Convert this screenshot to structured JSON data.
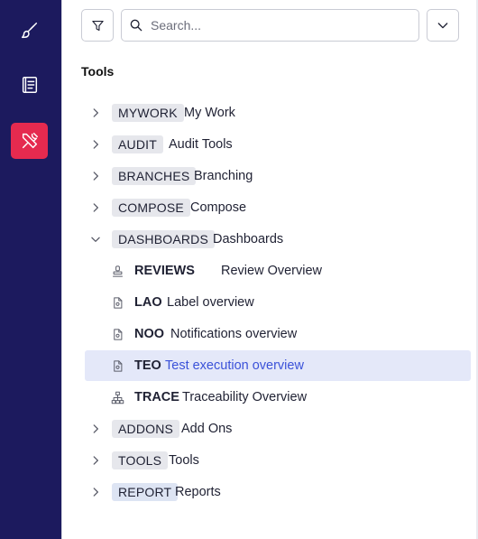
{
  "search": {
    "placeholder": "Search..."
  },
  "section_title": "Tools",
  "tree": {
    "mywork": {
      "code": "MYWORK",
      "label": "My Work"
    },
    "audit": {
      "code": "AUDIT",
      "label": "Audit Tools"
    },
    "branches": {
      "code": "BRANCHES",
      "label": "Branching"
    },
    "compose": {
      "code": "COMPOSE",
      "label": "Compose"
    },
    "dashboards": {
      "code": "DASHBOARDS",
      "label": "Dashboards",
      "children": {
        "reviews": {
          "code": "REVIEWS",
          "label": "Review Overview"
        },
        "lao": {
          "code": "LAO",
          "label": "Label overview"
        },
        "noo": {
          "code": "NOO",
          "label": "Notifications overview"
        },
        "teo": {
          "code": "TEO",
          "label": "Test execution overview"
        },
        "trace": {
          "code": "TRACE",
          "label": "Traceability Overview"
        }
      }
    },
    "addons": {
      "code": "ADDONS",
      "label": "Add Ons"
    },
    "tools": {
      "code": "TOOLS",
      "label": "Tools"
    },
    "report": {
      "code": "REPORT",
      "label": "Reports"
    }
  },
  "colors": {
    "rail": "#1c1a5e",
    "active": "#e52a4f",
    "selected_bg": "#e4e8f9",
    "selected_text": "#3b52d9"
  },
  "icons": [
    "brush-icon",
    "book-icon",
    "tools-icon",
    "filter-icon",
    "search-icon",
    "chevron-down-icon",
    "chevron-right-icon",
    "stamp-icon",
    "document-icon",
    "hierarchy-icon"
  ]
}
